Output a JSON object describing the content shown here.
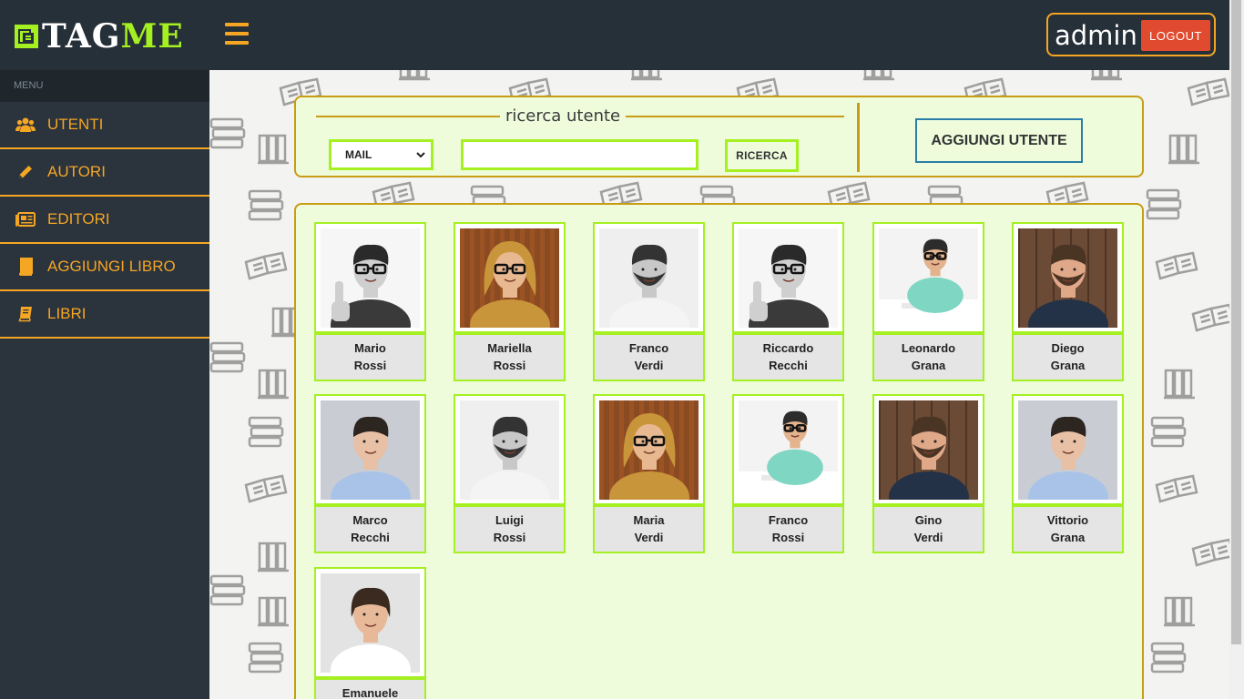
{
  "brand": {
    "logo_tag": "TAG",
    "logo_me": "ME",
    "accent": "#a4f020",
    "orange": "#f5a623"
  },
  "header": {
    "username": "admin",
    "logout_label": "LOGOUT"
  },
  "sidebar": {
    "menu_label": "MENU",
    "items": [
      {
        "label": "UTENTI",
        "icon": "users-icon"
      },
      {
        "label": "AUTORI",
        "icon": "pencil-icon"
      },
      {
        "label": "EDITORI",
        "icon": "newspaper-icon"
      },
      {
        "label": "AGGIUNGI LIBRO",
        "icon": "book-icon"
      },
      {
        "label": "LIBRI",
        "icon": "book-open-icon"
      }
    ]
  },
  "search": {
    "legend": "ricerca utente",
    "select_value": "MAIL",
    "input_value": "",
    "button_label": "RICERCA",
    "add_user_label": "AGGIUNGI UTENTE"
  },
  "users": [
    {
      "first": "Mario",
      "last": "Rossi",
      "photo": "bw-man-glasses"
    },
    {
      "first": "Mariella",
      "last": "Rossi",
      "photo": "woman-glasses"
    },
    {
      "first": "Franco",
      "last": "Verdi",
      "photo": "bw-man-beard"
    },
    {
      "first": "Riccardo",
      "last": "Recchi",
      "photo": "bw-man-glasses"
    },
    {
      "first": "Leonardo",
      "last": "Grana",
      "photo": "man-desk"
    },
    {
      "first": "Diego",
      "last": "Grana",
      "photo": "man-wood"
    },
    {
      "first": "Marco",
      "last": "Recchi",
      "photo": "man-shirt"
    },
    {
      "first": "Luigi",
      "last": "Rossi",
      "photo": "bw-man-beard"
    },
    {
      "first": "Maria",
      "last": "Verdi",
      "photo": "woman-glasses"
    },
    {
      "first": "Franco",
      "last": "Rossi",
      "photo": "man-desk"
    },
    {
      "first": "Gino",
      "last": "Verdi",
      "photo": "man-wood"
    },
    {
      "first": "Vittorio",
      "last": "Grana",
      "photo": "man-shirt"
    },
    {
      "first": "Emanuele",
      "last": "",
      "photo": "man-white-shirt"
    }
  ]
}
